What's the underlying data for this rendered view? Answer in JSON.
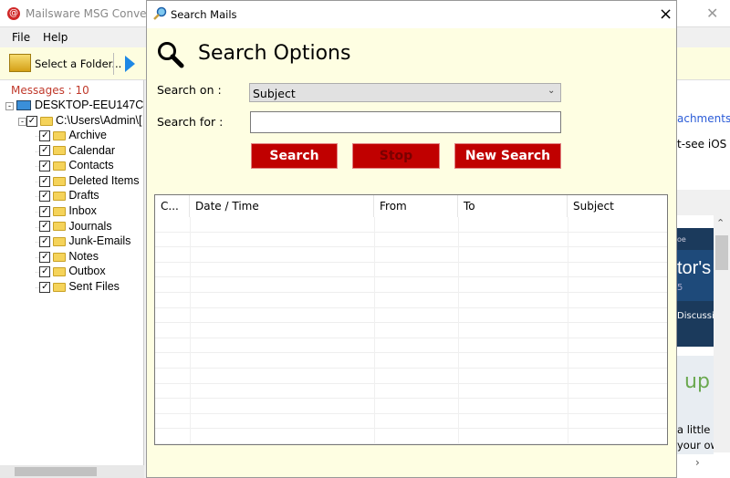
{
  "app": {
    "title": "Mailsware MSG Converter T",
    "logo": "@",
    "menu": [
      "File",
      "Help"
    ],
    "toolbar": {
      "select_folder": "Select a Folder..."
    },
    "messages_count": "Messages : 10"
  },
  "tree": {
    "root": "DESKTOP-EEU147C",
    "path": "C:\\Users\\Admin\\[",
    "folders": [
      "Archive",
      "Calendar",
      "Contacts",
      "Deleted Items",
      "Drafts",
      "Inbox",
      "Journals",
      "Junk-Emails",
      "Notes",
      "Outbox",
      "Sent Files"
    ]
  },
  "right_pane": {
    "link": "achments",
    "text1": "t-see iOS",
    "card_top": "oe",
    "card_title": "tor's",
    "card_num": "5",
    "card_link": "Discussi",
    "signup": "up",
    "text2": "a little",
    "text3": "your ow"
  },
  "dialog": {
    "title": "Search Mails",
    "heading": "Search Options",
    "search_on_label": "Search on :",
    "search_on_value": "Subject",
    "search_for_label": "Search for :",
    "search_for_value": "",
    "buttons": {
      "search": "Search",
      "stop": "Stop",
      "new_search": "New Search"
    },
    "columns": [
      "C...",
      "Date / Time",
      "From",
      "To",
      "Subject"
    ],
    "close": "×"
  },
  "colors": {
    "button": "#c00000",
    "dialog_bg": "#fefee2",
    "messages": "#c0392b"
  }
}
